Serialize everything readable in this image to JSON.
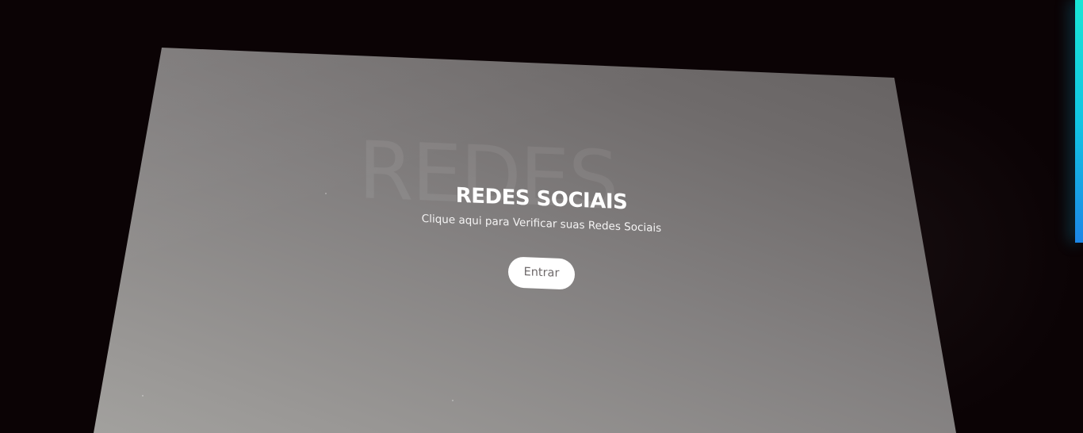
{
  "card": {
    "watermark": "REDES",
    "title": "REDES SOCIAIS",
    "subtitle": "Clique aqui para Verificar suas Redes Sociais",
    "button_label": "Entrar"
  },
  "colors": {
    "background": "#0b0305",
    "accent_top": "#19e6d5",
    "accent_bottom": "#1c86e6",
    "button_bg": "#ffffff",
    "button_text": "#6f6a6b"
  },
  "icons": {
    "accent": "vertical-gradient-bar"
  }
}
